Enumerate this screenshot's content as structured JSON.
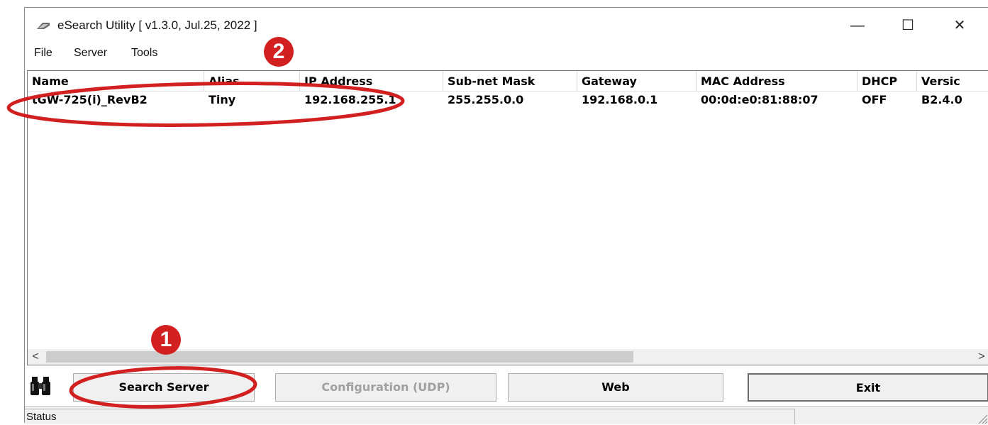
{
  "window": {
    "title": "eSearch Utility [ v1.3.0, Jul.25, 2022 ]",
    "controls": [
      "—",
      "☐",
      "✕"
    ]
  },
  "menu": [
    "File",
    "Server",
    "Tools"
  ],
  "table": {
    "columns": [
      "Name",
      "Alias",
      "IP Address",
      "Sub-net Mask",
      "Gateway",
      "MAC Address",
      "DHCP",
      "Versic"
    ],
    "rows": [
      [
        "tGW-725(i)_RevB2",
        "Tiny",
        "192.168.255.1",
        "255.255.0.0",
        "192.168.0.1",
        "00:0d:e0:81:88:07",
        "OFF",
        "B2.4.0"
      ]
    ]
  },
  "scroll": {
    "left": "<",
    "right": ">"
  },
  "buttons": {
    "search": "Search Server",
    "config": "Configuration (UDP)",
    "web": "Web",
    "exit": "Exit"
  },
  "status": {
    "label": "Status"
  },
  "annotations": {
    "badge1": "1",
    "badge2": "2",
    "color": "#d21f1f"
  }
}
